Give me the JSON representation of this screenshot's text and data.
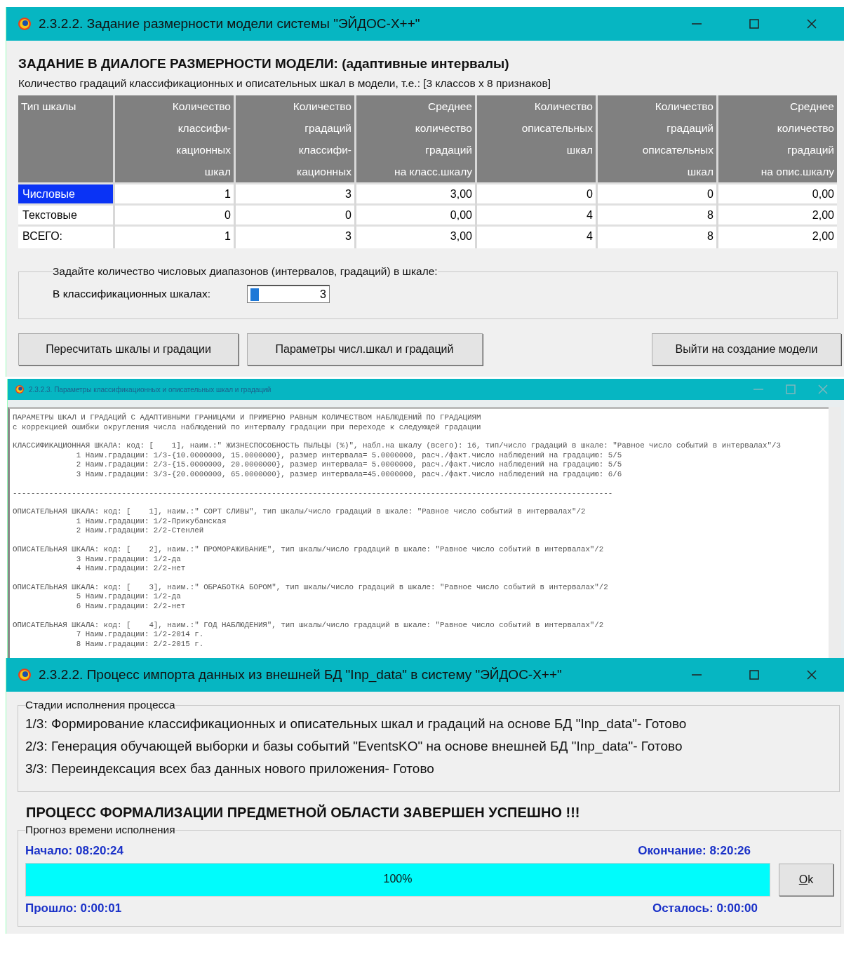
{
  "dimension_window": {
    "title": "2.3.2.2. Задание размерности модели системы \"ЭЙДОС-X++\"",
    "heading": "ЗАДАНИЕ В ДИАЛОГЕ РАЗМЕРНОСТИ МОДЕЛИ: (адаптивные интервалы)",
    "subtitle": "Количество градаций классификационных и описательных шкал в модели, т.е.: [3 классов x 8 признаков]",
    "table": {
      "columns": [
        "Тип шкалы",
        "Количество\nклассифи-\nкационных\nшкал",
        "Количество\nградаций\nклассифи-\nкационных",
        "Среднее\nколичество\nградаций\nна класс.шкалу",
        "Количество\nописательных\nшкал",
        "Количество\nградаций\nописательных\nшкал",
        "Среднее\nколичество\nградаций\nна опис.шкалу"
      ],
      "rows": [
        {
          "selected": true,
          "cells": [
            "Числовые",
            "1",
            "3",
            "3,00",
            "0",
            "0",
            "0,00"
          ]
        },
        {
          "selected": false,
          "cells": [
            "Текстовые",
            "0",
            "0",
            "0,00",
            "4",
            "8",
            "2,00"
          ]
        },
        {
          "selected": false,
          "cells": [
            "ВСЕГО:",
            "1",
            "3",
            "3,00",
            "4",
            "8",
            "2,00"
          ]
        }
      ]
    },
    "group": {
      "title": "Задайте количество числовых диапазонов (интервалов, градаций) в шкале:",
      "label": "В классификационных шкалах:",
      "value": "3"
    },
    "buttons": [
      "Пересчитать шкалы и градации",
      "Параметры числ.шкал и градаций",
      "Выйти на создание модели"
    ]
  },
  "params_window": {
    "title": "2.3.2.3. Параметры классификационных и описательных шкал и градаций",
    "blocks": [
      [
        "ПАРАМЕТРЫ ШКАЛ И ГРАДАЦИЙ С АДАПТИВНЫМИ ГРАНИЦАМИ И ПРИМЕРНО РАВНЫМ КОЛИЧЕСТВОМ НАБЛЮДЕНИЙ ПО ГРАДАЦИЯМ",
        "с коррекцией ошибки округления числа наблюдений по интервалу градации при переходе к следующей градации"
      ],
      [
        "КЛАССИФИКАЦИОННАЯ ШКАЛА: код: [    1], наим.:\" ЖИЗНЕСПОСОБНОСТЬ ПЫЛЬЦЫ (%)\", набл.на шкалу (всего): 16, тип/число градаций в шкале: \"Равное число событий в интервалах\"/3",
        "              1 Наим.градации: 1/3-{10.0000000, 15.0000000}, размер интервала= 5.0000000, расч./факт.число наблюдений на градацию: 5/5",
        "              2 Наим.градации: 2/3-{15.0000000, 20.0000000}, размер интервала= 5.0000000, расч./факт.число наблюдений на градацию: 5/5",
        "              3 Наим.градации: 3/3-{20.0000000, 65.0000000}, размер интервала=45.0000000, расч./факт.число наблюдений на градацию: 6/6"
      ],
      [
        "------------------------------------------------------------------------------------------------------------------------------------"
      ],
      [
        "ОПИСАТЕЛЬНАЯ ШКАЛА: код: [    1], наим.:\" СОРТ СЛИВЫ\", тип шкалы/число градаций в шкале: \"Равное число событий в интервалах\"/2",
        "              1 Наим.градации: 1/2-Прикубанская",
        "              2 Наим.градации: 2/2-Стенлей"
      ],
      [
        "ОПИСАТЕЛЬНАЯ ШКАЛА: код: [    2], наим.:\" ПРОМОРАЖИВАНИЕ\", тип шкалы/число градаций в шкале: \"Равное число событий в интервалах\"/2",
        "              3 Наим.градации: 1/2-да",
        "              4 Наим.градации: 2/2-нет"
      ],
      [
        "ОПИСАТЕЛЬНАЯ ШКАЛА: код: [    3], наим.:\" ОБРАБОТКА БОРОМ\", тип шкалы/число градаций в шкале: \"Равное число событий в интервалах\"/2",
        "              5 Наим.градации: 1/2-да",
        "              6 Наим.градации: 2/2-нет"
      ],
      [
        "ОПИСАТЕЛЬНАЯ ШКАЛА: код: [    4], наим.:\" ГОД НАБЛЮДЕНИЯ\", тип шкалы/число градаций в шкале: \"Равное число событий в интервалах\"/2",
        "              7 Наим.градации: 1/2-2014 г.",
        "              8 Наим.градации: 2/2-2015 г."
      ]
    ]
  },
  "import_window": {
    "title": "2.3.2.2. Процесс импорта данных из внешней БД \"Inp_data\" в систему \"ЭЙДОС-X++\"",
    "stages": {
      "title": "Стадии исполнения процесса",
      "lines": [
        "1/3: Формирование классификационных и описательных шкал и градаций на основе  БД \"Inp_data\"- Готово",
        "2/3: Генерация обучающей выборки и базы событий \"EventsKO\" на основе внешней БД \"Inp_data\"- Готово",
        "3/3: Переиндексация всех баз данных нового приложения- Готово"
      ]
    },
    "result": "ПРОЦЕСС ФОРМАЛИЗАЦИИ ПРЕДМЕТНОЙ ОБЛАСТИ ЗАВЕРШЕН УСПЕШНО !!!",
    "forecast": {
      "title": "Прогноз времени исполнения",
      "start": "Начало: 08:20:24",
      "end": "Окончание: 8:20:26",
      "progress": {
        "level": 1.0,
        "label": "100%"
      },
      "elapsed": "Прошло: 0:00:01",
      "remaining": "Осталось: 0:00:00",
      "ok": "Ok"
    }
  }
}
